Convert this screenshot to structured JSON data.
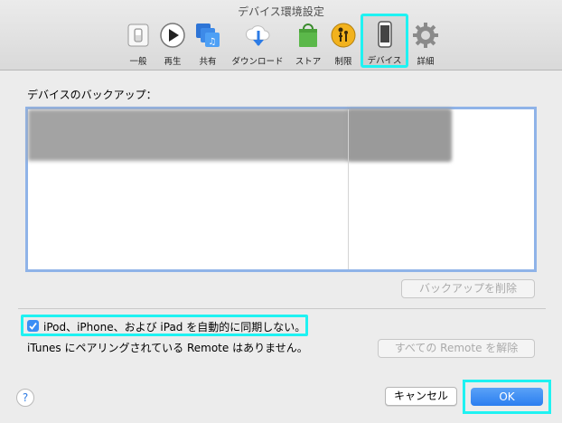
{
  "window": {
    "title": "デバイス環境設定"
  },
  "toolbar": {
    "items": [
      {
        "label": "一般",
        "icon": "general-switch-icon"
      },
      {
        "label": "再生",
        "icon": "play-icon"
      },
      {
        "label": "共有",
        "icon": "sharing-icon"
      },
      {
        "label": "ダウンロード",
        "icon": "download-cloud-icon"
      },
      {
        "label": "ストア",
        "icon": "store-bag-icon"
      },
      {
        "label": "制限",
        "icon": "parental-controls-icon"
      },
      {
        "label": "デバイス",
        "icon": "device-iphone-icon"
      },
      {
        "label": "詳細",
        "icon": "gear-icon"
      }
    ],
    "selected_index": 6
  },
  "backup": {
    "section_label": "デバイスのバックアップ：",
    "delete_button": "バックアップを削除"
  },
  "sync": {
    "checkbox_label": "iPod、iPhone、および iPad を自動的に同期しない。",
    "checked": true,
    "remote_text": "iTunes にペアリングされている Remote はありません。",
    "unpair_button": "すべての Remote を解除"
  },
  "footer": {
    "help": "?",
    "cancel": "キャンセル",
    "ok": "OK"
  },
  "colors": {
    "accent": "#3b8ef5",
    "highlight": "#1ff2f2"
  }
}
